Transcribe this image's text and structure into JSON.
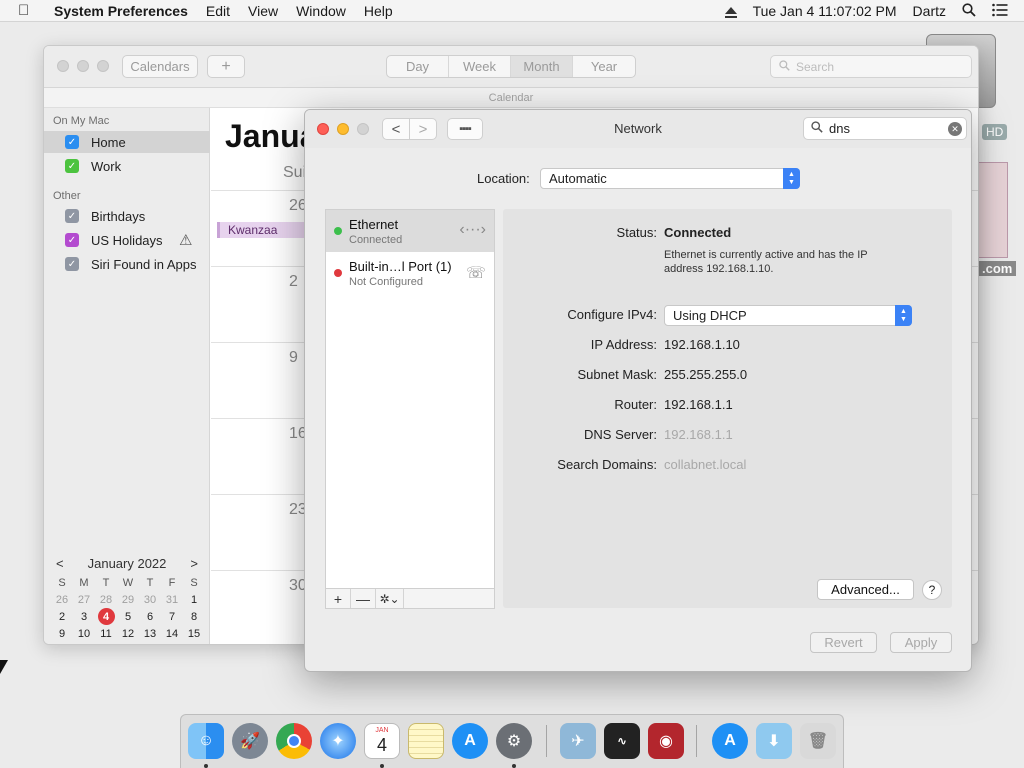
{
  "menubar": {
    "app_name": "System Preferences",
    "items": [
      "Edit",
      "View",
      "Window",
      "Help"
    ],
    "clock": "Tue Jan 4  11:07:02 PM",
    "user": "Dartz"
  },
  "desktop": {
    "disk_label": "HD",
    "file_label": ".com"
  },
  "calendar_window": {
    "toolbar": {
      "calendars_button": "Calendars",
      "add_button": "+",
      "views": [
        "Day",
        "Week",
        "Month",
        "Year"
      ],
      "selected_view": "Month",
      "search_placeholder": "Search"
    },
    "subtitle": "Calendar",
    "sidebar": {
      "section_on_my_mac": "On My Mac",
      "on_my_mac": [
        {
          "label": "Home",
          "color": "#2b8ef0",
          "checked": true,
          "selected": true
        },
        {
          "label": "Work",
          "color": "#4cc33f",
          "checked": true,
          "selected": false
        }
      ],
      "section_other": "Other",
      "other": [
        {
          "label": "Birthdays",
          "color": "#8f96a3",
          "checked": true
        },
        {
          "label": "US Holidays",
          "color": "#b34bcf",
          "checked": true,
          "warning": true
        },
        {
          "label": "Siri Found in Apps",
          "color": "#8f96a3",
          "checked": true
        }
      ]
    },
    "mini_calendar": {
      "month": "January 2022",
      "prev": "<",
      "next": ">",
      "weekdays": [
        "S",
        "M",
        "T",
        "W",
        "T",
        "F",
        "S"
      ],
      "weeks": [
        [
          "26",
          "27",
          "28",
          "29",
          "30",
          "31",
          "1"
        ],
        [
          "2",
          "3",
          "4",
          "5",
          "6",
          "7",
          "8"
        ],
        [
          "9",
          "10",
          "11",
          "12",
          "13",
          "14",
          "15"
        ],
        [
          "16",
          "17",
          "18",
          "19",
          "20",
          "21",
          "22"
        ],
        [
          "23",
          "24",
          "25",
          "26",
          "27",
          "28",
          "29"
        ],
        [
          "30",
          "31",
          "1",
          "2",
          "3",
          "4",
          "5"
        ]
      ],
      "today": "4"
    },
    "main": {
      "month_title": "Janua",
      "day_name": "Sui",
      "week_day_numbers": [
        "26",
        "2",
        "9",
        "16",
        "23",
        "30"
      ],
      "event": "Kwanzaa"
    }
  },
  "network_window": {
    "title": "Network",
    "nav_back": "<",
    "nav_forward": ">",
    "search_value": "dns",
    "location_label": "Location:",
    "location_value": "Automatic",
    "services": [
      {
        "name": "Ethernet",
        "status": "Connected",
        "status_color": "#3cbf4c",
        "selected": true
      },
      {
        "name": "Built-in…l Port (1)",
        "status": "Not Configured",
        "status_color": "#e0393e",
        "selected": false
      }
    ],
    "list_footer": {
      "add": "+",
      "remove": "—",
      "action": "✲⌄"
    },
    "details": {
      "status_label": "Status:",
      "status_value": "Connected",
      "status_description": "Ethernet is currently active and has the IP address 192.168.1.10.",
      "configure_label": "Configure IPv4:",
      "configure_value": "Using DHCP",
      "ip_label": "IP Address:",
      "ip_value": "192.168.1.10",
      "subnet_label": "Subnet Mask:",
      "subnet_value": "255.255.255.0",
      "router_label": "Router:",
      "router_value": "192.168.1.1",
      "dns_label": "DNS Server:",
      "dns_value": "192.168.1.1",
      "search_domains_label": "Search Domains:",
      "search_domains_value": "collabnet.local",
      "advanced_button": "Advanced...",
      "help_button": "?"
    },
    "revert_button": "Revert",
    "apply_button": "Apply"
  },
  "dock": {
    "calendar_month": "JAN",
    "calendar_day": "4",
    "apps": [
      "finder",
      "launchpad",
      "chrome",
      "safari",
      "calendar",
      "notes",
      "app-store",
      "system-preferences",
      "preview",
      "activity-monitor",
      "photo-booth",
      "app-store-downloads",
      "downloads-folder",
      "trash"
    ]
  }
}
